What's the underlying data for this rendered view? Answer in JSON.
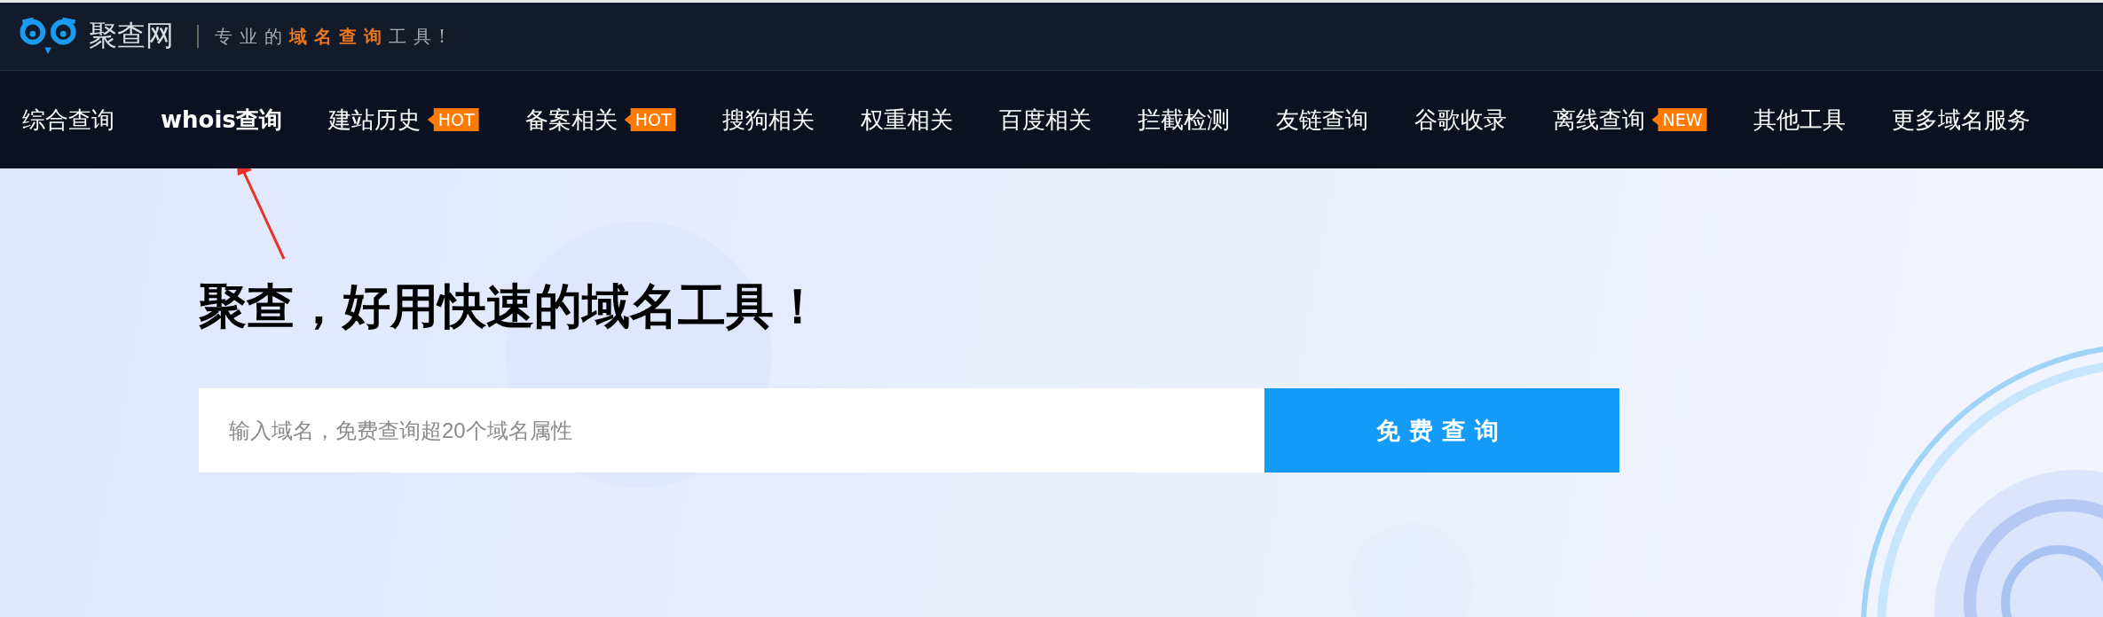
{
  "header": {
    "logo_text": "聚查网",
    "slogan": [
      {
        "text": "专业的",
        "highlight": false
      },
      {
        "text": "域名查询",
        "highlight": true
      },
      {
        "text": "工具!",
        "highlight": false
      }
    ]
  },
  "nav": [
    {
      "label": "综合查询",
      "selected": false
    },
    {
      "label": "whois查询",
      "selected": true
    },
    {
      "label": "建站历史",
      "selected": false,
      "badge": "HOT"
    },
    {
      "label": "备案相关",
      "selected": false,
      "badge": "HOT"
    },
    {
      "label": "搜狗相关",
      "selected": false
    },
    {
      "label": "权重相关",
      "selected": false
    },
    {
      "label": "百度相关",
      "selected": false
    },
    {
      "label": "拦截检测",
      "selected": false
    },
    {
      "label": "友链查询",
      "selected": false
    },
    {
      "label": "谷歌收录",
      "selected": false
    },
    {
      "label": "离线查询",
      "selected": false,
      "badge": "NEW"
    },
    {
      "label": "其他工具",
      "selected": false
    },
    {
      "label": "更多域名服务",
      "selected": false
    }
  ],
  "hero": {
    "title": "聚查，好用快速的域名工具！",
    "search": {
      "placeholder": "输入域名，免费查询超20个域名属性",
      "button": "免费查询"
    }
  }
}
